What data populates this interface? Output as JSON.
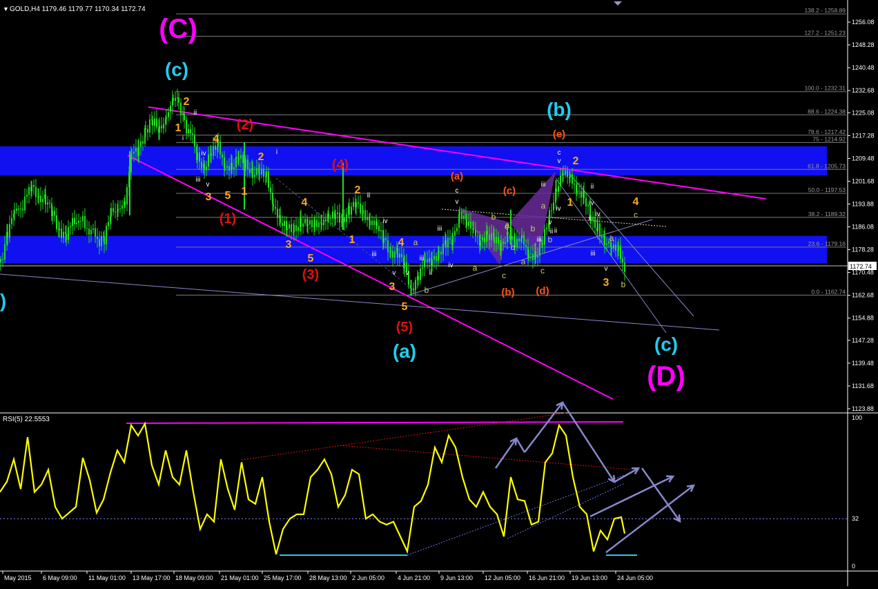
{
  "window": {
    "symbol_info": "GOLD,H4  1179.46 1179.77 1170.34 1172.74",
    "current_price": "1172.74",
    "menu_glyph": "▼"
  },
  "colors": {
    "background": "#000000",
    "candle": "#22dd22",
    "zone": "#1010f0",
    "magenta": "#ff00ff",
    "cyan": "#22ccee",
    "orange": "#ffaa22",
    "red": "#dd1111",
    "dark_orange": "#ff5511",
    "rsi": "#ffff00",
    "steel": "#8888cc",
    "axis_text": "#ffffff"
  },
  "chart_data": [
    {
      "type": "line",
      "subtype": "candlestick",
      "instrument": "GOLD",
      "timeframe": "H4",
      "ylim": [
        1123.88,
        1262
      ],
      "y_ticks": [
        "1256.08",
        "1248.28",
        "1240.48",
        "1232.68",
        "1225.08",
        "1217.28",
        "1209.48",
        "1201.68",
        "1193.88",
        "1186.08",
        "1178.28",
        "1170.48",
        "1162.68",
        "1154.88",
        "1147.28",
        "1139.48",
        "1131.68",
        "1123.88"
      ],
      "x_ticks": [
        "May 2015",
        "6 May 09:00",
        "11 May 01:00",
        "13 May 17:00",
        "18 May 09:00",
        "21 May 01:00",
        "25 May 17:00",
        "28 May 13:00",
        "2 Jun 05:00",
        "4 Jun 21:00",
        "9 Jun 13:00",
        "12 Jun 05:00",
        "16 Jun 21:00",
        "19 Jun 13:00",
        "24 Jun 05:00"
      ],
      "price_path": [
        [
          0,
          1174
        ],
        [
          10,
          1185
        ],
        [
          20,
          1190
        ],
        [
          35,
          1195
        ],
        [
          45,
          1200
        ],
        [
          55,
          1197
        ],
        [
          65,
          1195
        ],
        [
          75,
          1190
        ],
        [
          85,
          1185
        ],
        [
          95,
          1184
        ],
        [
          110,
          1189
        ],
        [
          125,
          1186
        ],
        [
          140,
          1182
        ],
        [
          150,
          1182
        ],
        [
          160,
          1190
        ],
        [
          170,
          1193
        ],
        [
          180,
          1195
        ],
        [
          190,
          1210
        ],
        [
          200,
          1213
        ],
        [
          210,
          1220
        ],
        [
          220,
          1222
        ],
        [
          230,
          1218
        ],
        [
          240,
          1225
        ],
        [
          250,
          1230
        ],
        [
          258,
          1229
        ],
        [
          266,
          1222
        ],
        [
          275,
          1218
        ],
        [
          285,
          1210
        ],
        [
          295,
          1207
        ],
        [
          305,
          1211
        ],
        [
          315,
          1213
        ],
        [
          325,
          1208
        ],
        [
          335,
          1206
        ],
        [
          345,
          1209
        ],
        [
          355,
          1208
        ],
        [
          365,
          1205
        ],
        [
          375,
          1204
        ],
        [
          385,
          1203
        ],
        [
          395,
          1195
        ],
        [
          405,
          1187
        ],
        [
          415,
          1185
        ],
        [
          425,
          1186
        ],
        [
          435,
          1188
        ],
        [
          445,
          1186
        ],
        [
          455,
          1187
        ],
        [
          465,
          1189
        ],
        [
          475,
          1188
        ],
        [
          485,
          1190
        ],
        [
          495,
          1189
        ],
        [
          505,
          1192
        ],
        [
          515,
          1193
        ],
        [
          525,
          1191
        ],
        [
          535,
          1189
        ],
        [
          545,
          1185
        ],
        [
          555,
          1182
        ],
        [
          565,
          1178
        ],
        [
          575,
          1177
        ],
        [
          585,
          1172
        ],
        [
          595,
          1165
        ],
        [
          605,
          1170
        ],
        [
          615,
          1173
        ],
        [
          625,
          1175
        ],
        [
          635,
          1178
        ],
        [
          645,
          1180
        ],
        [
          655,
          1181
        ],
        [
          665,
          1192
        ],
        [
          675,
          1188
        ],
        [
          685,
          1183
        ],
        [
          695,
          1182
        ],
        [
          705,
          1184
        ],
        [
          715,
          1181
        ],
        [
          725,
          1179
        ],
        [
          735,
          1185
        ],
        [
          745,
          1180
        ],
        [
          755,
          1181
        ],
        [
          765,
          1178
        ],
        [
          775,
          1176
        ],
        [
          785,
          1180
        ],
        [
          795,
          1190
        ],
        [
          805,
          1200
        ],
        [
          815,
          1204
        ],
        [
          825,
          1202
        ],
        [
          835,
          1200
        ],
        [
          845,
          1196
        ],
        [
          855,
          1188
        ],
        [
          865,
          1186
        ],
        [
          875,
          1182
        ],
        [
          885,
          1178
        ],
        [
          895,
          1178
        ],
        [
          905,
          1172
        ]
      ],
      "levels": [
        {
          "label": "138.2 - 1258.89",
          "price": 1258.89
        },
        {
          "label": "127.2 - 1251.23",
          "price": 1251.23
        },
        {
          "label": "100.0 - 1232.31",
          "price": 1232.31
        },
        {
          "label": "88.6 - 1224.38",
          "price": 1224.38
        },
        {
          "label": "78.6 - 1217.42",
          "price": 1217.42
        },
        {
          "label": "75 - 1214.92",
          "price": 1214.92
        },
        {
          "label": "61.8 - 1205.73",
          "price": 1205.73
        },
        {
          "label": "50.0 - 1197.53",
          "price": 1197.53
        },
        {
          "label": "38.2 - 1189.32",
          "price": 1189.32
        },
        {
          "label": "23.6 - 1179.16",
          "price": 1179.16
        },
        {
          "label": "0.0 - 1162.74",
          "price": 1162.74
        }
      ],
      "zones": [
        [
          1203.6,
          1213.6
        ],
        [
          1173.6,
          1183.0
        ]
      ],
      "wave_labels": [
        {
          "t": "(C)",
          "c": "magenta",
          "s": 40
        },
        {
          "t": "(D)",
          "c": "magenta",
          "s": 40
        },
        {
          "t": "(c)",
          "c": "cyan",
          "s": 28
        },
        {
          "t": "(b)",
          "c": "cyan",
          "s": 28
        },
        {
          "t": "(a)",
          "c": "cyan",
          "s": 28
        },
        {
          "t": "(c)",
          "c": "cyan",
          "s": 28
        },
        {
          "t": "b)",
          "c": "cyan",
          "s": 28
        },
        {
          "t": "(1)",
          "c": "red",
          "s": 20
        },
        {
          "t": "(2)",
          "c": "red",
          "s": 20
        },
        {
          "t": "(3)",
          "c": "red",
          "s": 20
        },
        {
          "t": "(4)",
          "c": "red",
          "s": 20
        },
        {
          "t": "(5)",
          "c": "red",
          "s": 20
        },
        {
          "t": "(a)",
          "c": "dark_orange",
          "s": 15
        },
        {
          "t": "(b)",
          "c": "dark_orange",
          "s": 15
        },
        {
          "t": "(c)",
          "c": "dark_orange",
          "s": 15
        },
        {
          "t": "(d)",
          "c": "dark_orange",
          "s": 15
        },
        {
          "t": "(e)",
          "c": "dark_orange",
          "s": 15
        },
        {
          "t": "1",
          "c": "orange",
          "s": 16
        },
        {
          "t": "2",
          "c": "orange",
          "s": 16
        },
        {
          "t": "3",
          "c": "orange",
          "s": 16
        },
        {
          "t": "4",
          "c": "orange",
          "s": 16
        },
        {
          "t": "5",
          "c": "orange",
          "s": 16
        },
        {
          "t": "1",
          "c": "orange",
          "s": 16
        },
        {
          "t": "2",
          "c": "orange",
          "s": 16
        },
        {
          "t": "3",
          "c": "orange",
          "s": 16
        },
        {
          "t": "4",
          "c": "orange",
          "s": 16
        },
        {
          "t": "5",
          "c": "orange",
          "s": 16
        },
        {
          "t": "1",
          "c": "orange",
          "s": 16
        },
        {
          "t": "2",
          "c": "orange",
          "s": 16
        },
        {
          "t": "3",
          "c": "orange",
          "s": 16
        },
        {
          "t": "4",
          "c": "orange",
          "s": 16
        },
        {
          "t": "5",
          "c": "orange",
          "s": 16
        },
        {
          "t": "1",
          "c": "orange",
          "s": 16
        },
        {
          "t": "2",
          "c": "orange",
          "s": 16
        },
        {
          "t": "3",
          "c": "orange",
          "s": 16
        },
        {
          "t": "4",
          "c": "orange",
          "s": 16
        },
        {
          "t": "i",
          "c": "white",
          "s": 10
        },
        {
          "t": "ii",
          "c": "white",
          "s": 10
        },
        {
          "t": "iii",
          "c": "white",
          "s": 10
        },
        {
          "t": "iv",
          "c": "white",
          "s": 10
        },
        {
          "t": "v",
          "c": "white",
          "s": 10
        },
        {
          "t": "i",
          "c": "white",
          "s": 10
        },
        {
          "t": "ii",
          "c": "white",
          "s": 10
        },
        {
          "t": "iii",
          "c": "white",
          "s": 10
        },
        {
          "t": "iv",
          "c": "white",
          "s": 10
        },
        {
          "t": "v",
          "c": "white",
          "s": 10
        },
        {
          "t": "iii",
          "c": "white",
          "s": 10
        },
        {
          "t": "iv",
          "c": "white",
          "s": 10
        },
        {
          "t": "ii",
          "c": "white",
          "s": 10
        },
        {
          "t": "iii",
          "c": "white",
          "s": 10
        },
        {
          "t": "v",
          "c": "white",
          "s": 10
        },
        {
          "t": "c",
          "c": "white",
          "s": 10
        },
        {
          "t": "v",
          "c": "white",
          "s": 10
        },
        {
          "t": "iii",
          "c": "white",
          "s": 10
        },
        {
          "t": "iv",
          "c": "white",
          "s": 10
        },
        {
          "t": "ii",
          "c": "white",
          "s": 10
        },
        {
          "t": "iii",
          "c": "white",
          "s": 10
        },
        {
          "t": "iv",
          "c": "white",
          "s": 10
        },
        {
          "t": "ii",
          "c": "white",
          "s": 10
        },
        {
          "t": "iii",
          "c": "white",
          "s": 10
        },
        {
          "t": "v",
          "c": "white",
          "s": 10
        },
        {
          "t": "ii",
          "c": "white",
          "s": 10
        },
        {
          "t": "c",
          "c": "white",
          "s": 10
        },
        {
          "t": "v",
          "c": "white",
          "s": 10
        },
        {
          "t": "ii",
          "c": "white",
          "s": 10
        },
        {
          "t": "v",
          "c": "white",
          "s": 10
        },
        {
          "t": "iv",
          "c": "white",
          "s": 10
        },
        {
          "t": "a",
          "c": "khaki",
          "s": 12
        },
        {
          "t": "b",
          "c": "khaki",
          "s": 12
        },
        {
          "t": "a",
          "c": "khaki",
          "s": 12
        },
        {
          "t": "b",
          "c": "khaki",
          "s": 12
        },
        {
          "t": "a",
          "c": "khaki",
          "s": 12
        },
        {
          "t": "b",
          "c": "khaki",
          "s": 12
        },
        {
          "t": "c",
          "c": "khaki",
          "s": 12
        },
        {
          "t": "a",
          "c": "khaki",
          "s": 12
        },
        {
          "t": "b",
          "c": "khaki",
          "s": 12
        },
        {
          "t": "c",
          "c": "khaki",
          "s": 12
        },
        {
          "t": "a",
          "c": "khaki",
          "s": 12
        },
        {
          "t": "b",
          "c": "khaki",
          "s": 12
        },
        {
          "t": "c",
          "c": "khaki",
          "s": 12
        },
        {
          "t": "a",
          "c": "khaki",
          "s": 12
        },
        {
          "t": "b",
          "c": "khaki",
          "s": 12
        },
        {
          "t": "c",
          "c": "khaki",
          "s": 12
        }
      ]
    },
    {
      "type": "line",
      "title": "RSI(5) 22.5553",
      "ylim": [
        0,
        100
      ],
      "y_ticks": [
        "100",
        "32",
        "0"
      ],
      "level": 32,
      "values": [
        [
          0,
          50
        ],
        [
          10,
          57
        ],
        [
          20,
          72
        ],
        [
          30,
          52
        ],
        [
          40,
          87
        ],
        [
          50,
          50
        ],
        [
          60,
          55
        ],
        [
          70,
          65
        ],
        [
          80,
          40
        ],
        [
          90,
          32
        ],
        [
          100,
          36
        ],
        [
          110,
          40
        ],
        [
          120,
          73
        ],
        [
          130,
          58
        ],
        [
          140,
          36
        ],
        [
          150,
          45
        ],
        [
          160,
          63
        ],
        [
          170,
          78
        ],
        [
          180,
          70
        ],
        [
          190,
          95
        ],
        [
          200,
          88
        ],
        [
          210,
          96
        ],
        [
          220,
          68
        ],
        [
          230,
          55
        ],
        [
          240,
          78
        ],
        [
          250,
          60
        ],
        [
          260,
          55
        ],
        [
          270,
          78
        ],
        [
          280,
          50
        ],
        [
          290,
          25
        ],
        [
          300,
          35
        ],
        [
          310,
          30
        ],
        [
          320,
          72
        ],
        [
          330,
          52
        ],
        [
          340,
          38
        ],
        [
          350,
          70
        ],
        [
          360,
          45
        ],
        [
          370,
          42
        ],
        [
          380,
          60
        ],
        [
          390,
          30
        ],
        [
          400,
          8
        ],
        [
          410,
          25
        ],
        [
          420,
          32
        ],
        [
          430,
          35
        ],
        [
          440,
          35
        ],
        [
          450,
          60
        ],
        [
          460,
          65
        ],
        [
          470,
          72
        ],
        [
          480,
          62
        ],
        [
          490,
          40
        ],
        [
          500,
          48
        ],
        [
          510,
          65
        ],
        [
          520,
          62
        ],
        [
          530,
          32
        ],
        [
          540,
          35
        ],
        [
          550,
          30
        ],
        [
          560,
          28
        ],
        [
          570,
          30
        ],
        [
          580,
          20
        ],
        [
          590,
          10
        ],
        [
          600,
          40
        ],
        [
          610,
          44
        ],
        [
          620,
          55
        ],
        [
          630,
          80
        ],
        [
          640,
          70
        ],
        [
          650,
          88
        ],
        [
          660,
          80
        ],
        [
          670,
          60
        ],
        [
          680,
          45
        ],
        [
          690,
          40
        ],
        [
          700,
          50
        ],
        [
          710,
          40
        ],
        [
          720,
          35
        ],
        [
          730,
          20
        ],
        [
          740,
          60
        ],
        [
          750,
          45
        ],
        [
          760,
          44
        ],
        [
          770,
          28
        ],
        [
          780,
          30
        ],
        [
          790,
          70
        ],
        [
          800,
          76
        ],
        [
          810,
          95
        ],
        [
          820,
          88
        ],
        [
          830,
          60
        ],
        [
          840,
          40
        ],
        [
          850,
          35
        ],
        [
          860,
          10
        ],
        [
          870,
          24
        ],
        [
          880,
          18
        ],
        [
          890,
          32
        ],
        [
          900,
          33
        ],
        [
          905,
          22
        ]
      ]
    }
  ]
}
